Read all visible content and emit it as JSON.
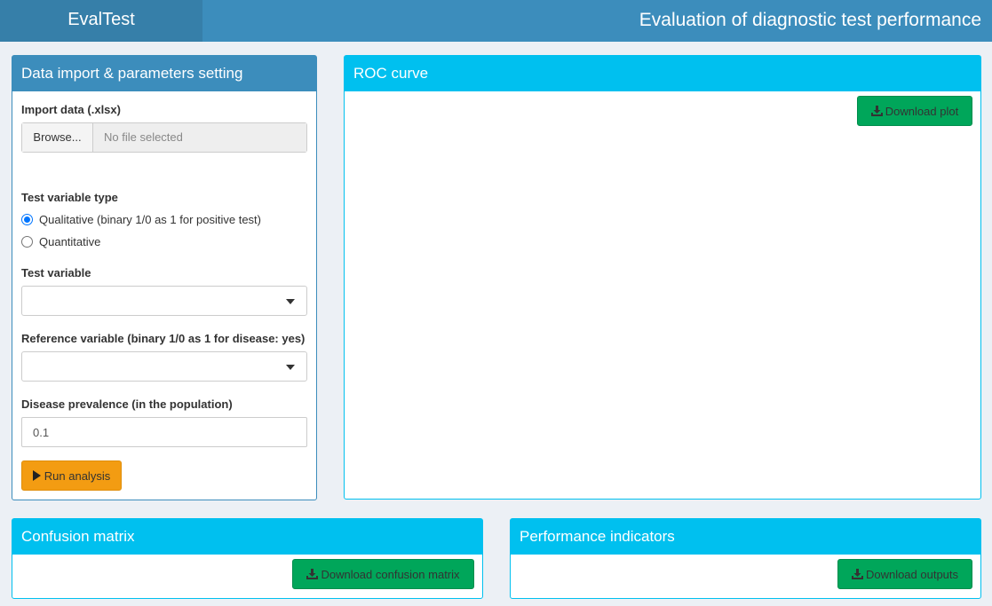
{
  "header": {
    "logo": "EvalTest",
    "title": "Evaluation of diagnostic test performance"
  },
  "data_panel": {
    "title": "Data import & parameters setting",
    "import_label": "Import data (.xlsx)",
    "browse_label": "Browse...",
    "file_placeholder": "No file selected",
    "type_label": "Test variable type",
    "type_options": [
      {
        "label": "Qualitative (binary 1/0 as 1 for positive test)",
        "selected": true
      },
      {
        "label": "Quantitative",
        "selected": false
      }
    ],
    "test_var_label": "Test variable",
    "test_var_value": "",
    "ref_var_label": "Reference variable (binary 1/0 as 1 for disease: yes)",
    "ref_var_value": "",
    "prevalence_label": "Disease prevalence (in the population)",
    "prevalence_value": "0.1",
    "run_label": "Run analysis"
  },
  "roc_panel": {
    "title": "ROC curve",
    "download_label": "Download plot"
  },
  "confusion_panel": {
    "title": "Confusion matrix",
    "download_label": "Download confusion matrix"
  },
  "performance_panel": {
    "title": "Performance indicators",
    "download_label": "Download outputs"
  },
  "colors": {
    "primary": "#3c8dbc",
    "info": "#00c0ef",
    "warning": "#f39c12",
    "success": "#00a65a",
    "background": "#ecf0f5"
  }
}
